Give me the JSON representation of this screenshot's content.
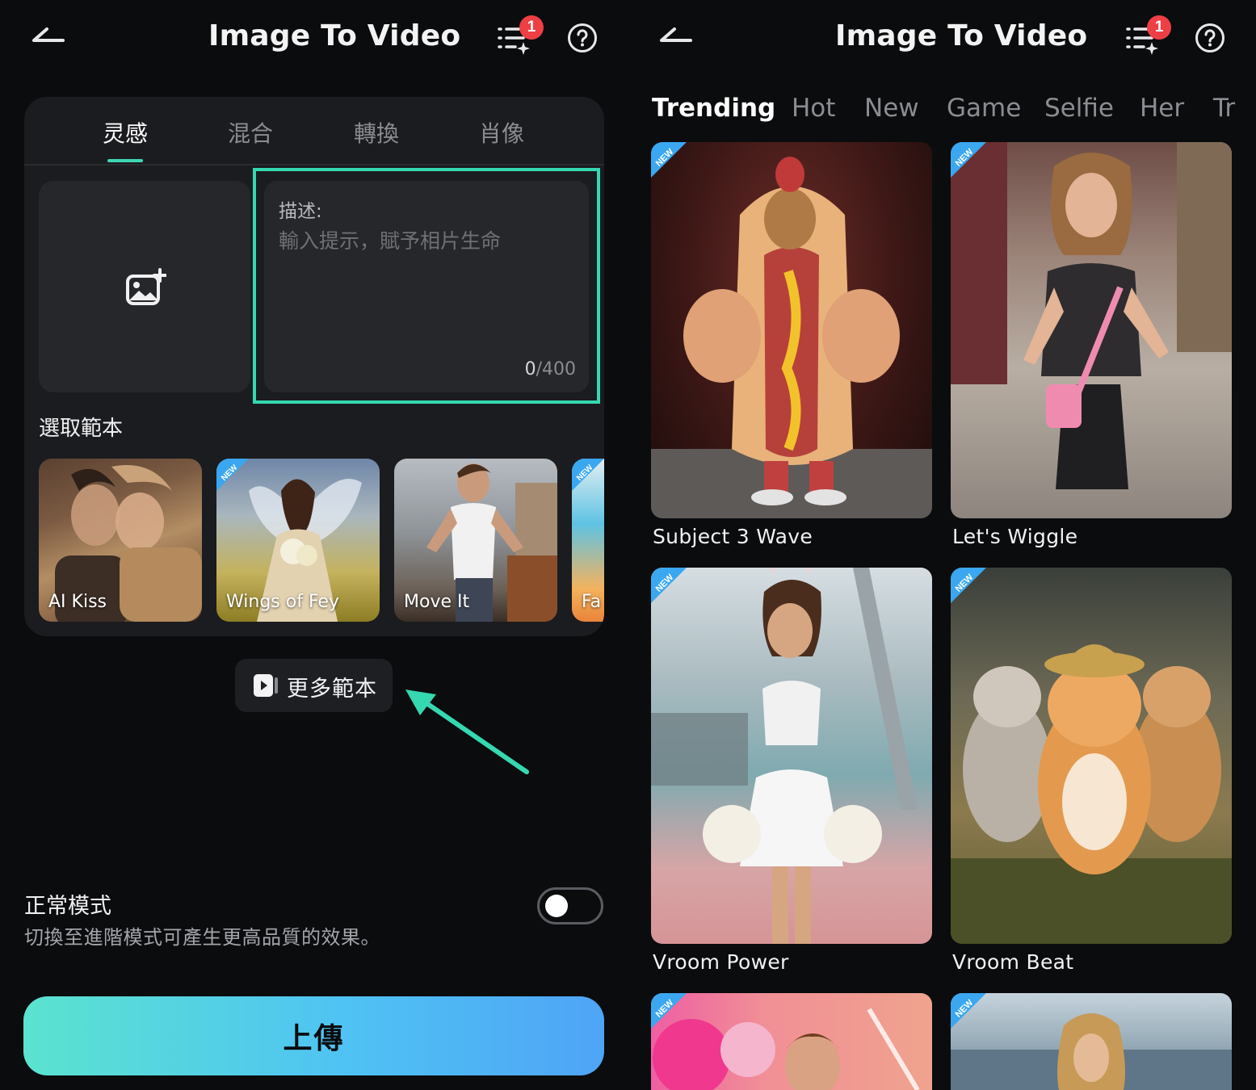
{
  "left": {
    "header": {
      "title": "Image To Video",
      "badge_count": "1"
    },
    "tabs": [
      {
        "label": "灵感",
        "active": true
      },
      {
        "label": "混合",
        "active": false
      },
      {
        "label": "轉換",
        "active": false
      },
      {
        "label": "肖像",
        "active": false
      }
    ],
    "description": {
      "label": "描述:",
      "placeholder": "輸入提示，賦予相片生命",
      "count": "0",
      "max": "/400"
    },
    "template_section_title": "選取範本",
    "templates": [
      {
        "label": "AI Kiss",
        "is_new": false
      },
      {
        "label": "Wings of Fey",
        "is_new": true
      },
      {
        "label": "Move It",
        "is_new": false
      },
      {
        "label": "Fa",
        "is_new": true
      }
    ],
    "more_templates_label": "更多範本",
    "mode": {
      "title": "正常模式",
      "description": "切換至進階模式可產生更高品質的效果。",
      "enabled": false
    },
    "upload_button_label": "上傳",
    "colors": {
      "accent": "#35d8b0",
      "badge": "#ee3f45",
      "button_start": "#5be3cf",
      "button_end": "#4fa4f6"
    }
  },
  "right": {
    "header": {
      "title": "Image To Video",
      "badge_count": "1"
    },
    "tabs": [
      {
        "label": "Trending",
        "active": true
      },
      {
        "label": "Hot",
        "active": false
      },
      {
        "label": "New",
        "active": false
      },
      {
        "label": "Game",
        "active": false
      },
      {
        "label": "Selfie",
        "active": false
      },
      {
        "label": "Her",
        "active": false
      },
      {
        "label": "Tr",
        "active": false
      }
    ],
    "tiles": [
      {
        "label": "Subject 3 Wave",
        "is_new": true
      },
      {
        "label": "Let's Wiggle",
        "is_new": true
      },
      {
        "label": "Vroom Power",
        "is_new": true
      },
      {
        "label": "Vroom Beat",
        "is_new": true
      },
      {
        "label": "",
        "is_new": true
      },
      {
        "label": "",
        "is_new": true
      }
    ]
  }
}
